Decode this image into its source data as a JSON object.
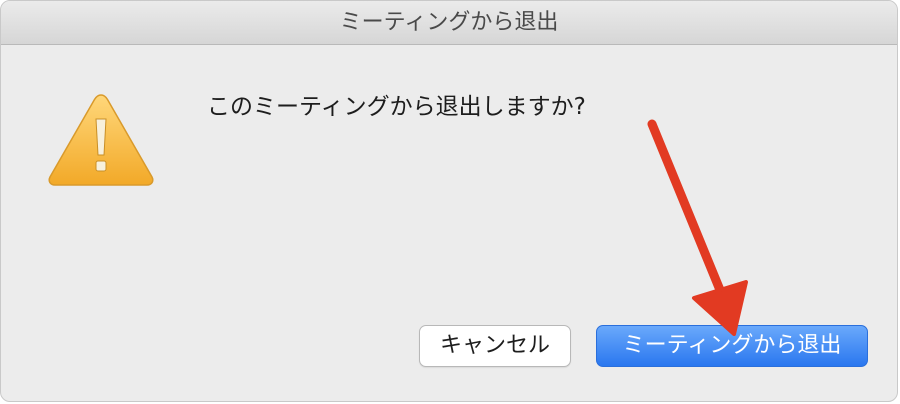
{
  "dialog": {
    "title": "ミーティングから退出",
    "message": "このミーティングから退出しますか?",
    "icon": "warning-icon",
    "buttons": {
      "cancel_label": "キャンセル",
      "leave_label": "ミーティングから退出"
    }
  },
  "colors": {
    "primary_button": "#2a77ef",
    "annotation_arrow": "#e23a22",
    "warning_icon": "#f4b63c"
  }
}
